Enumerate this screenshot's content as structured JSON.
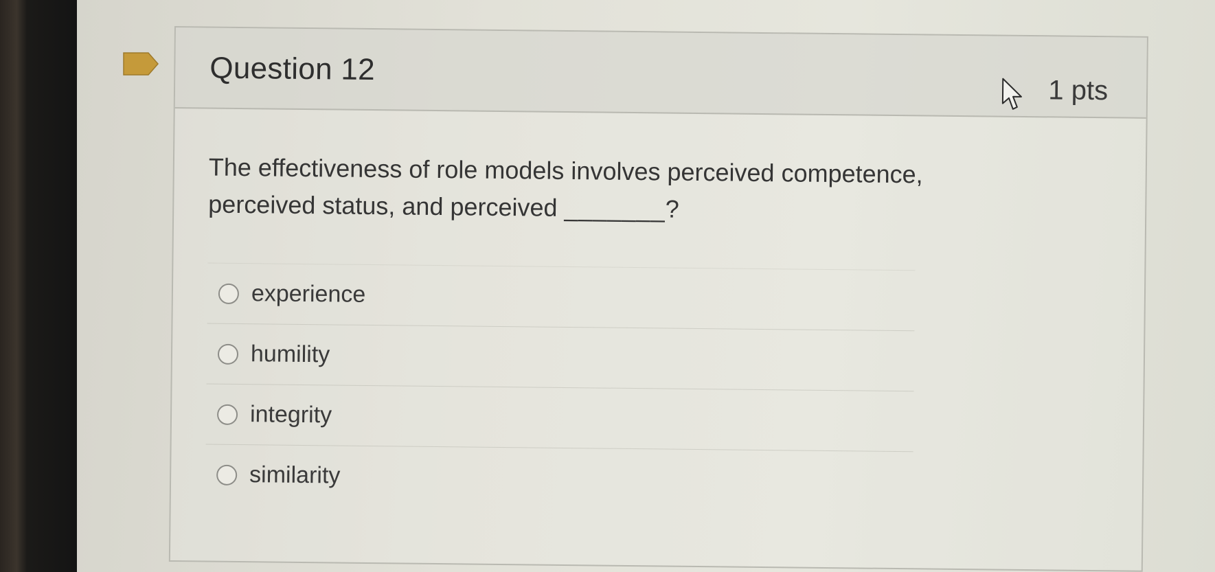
{
  "question": {
    "title": "Question 12",
    "points": "1 pts",
    "text_part1": "The effectiveness of role models involves perceived competence, perceived status, and perceived",
    "blank": "_______",
    "text_end": "?",
    "answers": [
      {
        "label": "experience"
      },
      {
        "label": "humility"
      },
      {
        "label": "integrity"
      },
      {
        "label": "similarity"
      }
    ]
  },
  "colors": {
    "flag": "#c59a3a",
    "border": "#b9b9b1"
  },
  "icons": [
    "bookmark-flag-icon",
    "mouse-cursor-icon"
  ]
}
